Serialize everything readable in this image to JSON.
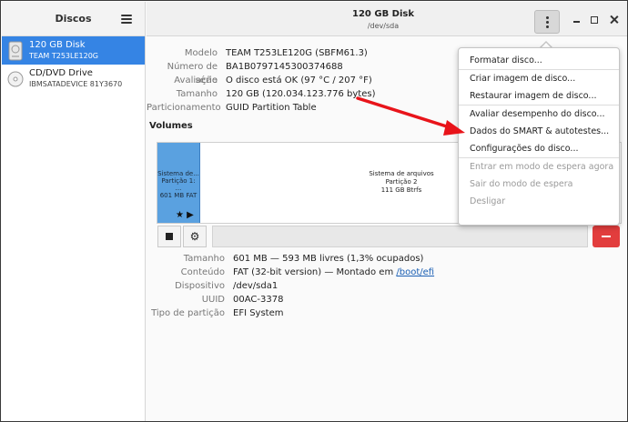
{
  "sidebar": {
    "title": "Discos",
    "items": [
      {
        "name": "120 GB Disk",
        "sub": "TEAM T253LE120G"
      },
      {
        "name": "CD/DVD Drive",
        "sub": "IBMSATADEVICE 81Y3670"
      }
    ]
  },
  "header": {
    "title": "120 GB Disk",
    "subtitle": "/dev/sda"
  },
  "disk_info": [
    {
      "label": "Modelo",
      "value": "TEAM T253LE120G (SBFM61.3)"
    },
    {
      "label": "Número de série",
      "value": "BA1B0797145300374688"
    },
    {
      "label": "Avaliação",
      "value": "O disco está OK (97 °C / 207 °F)"
    },
    {
      "label": "Tamanho",
      "value": "120 GB (120.034.123.776 bytes)"
    },
    {
      "label": "Particionamento",
      "value": "GUID Partition Table"
    }
  ],
  "volumes": {
    "title": "Volumes",
    "partitions": [
      {
        "line1": "Sistema de...",
        "line2": "Partição 1: ...",
        "line3": "601 MB FAT",
        "marks": "★ ▶"
      },
      {
        "line1": "Sistema de arquivos",
        "line2": "Partição 2",
        "line3": "111 GB Btrfs"
      }
    ]
  },
  "partition_details": {
    "size_label": "Tamanho",
    "size_value": "601 MB — 593 MB livres (1,3% ocupados)",
    "content_label": "Conteúdo",
    "content_value": "FAT (32-bit version) — Montado em ",
    "content_link": "/boot/efi",
    "device_label": "Dispositivo",
    "device_value": "/dev/sda1",
    "uuid_label": "UUID",
    "uuid_value": "00AC-3378",
    "type_label": "Tipo de partição",
    "type_value": "EFI System"
  },
  "menu": {
    "items": [
      {
        "label": "Formatar disco...",
        "enabled": true
      },
      {
        "label": "Criar imagem de disco...",
        "enabled": true
      },
      {
        "label": "Restaurar imagem de disco...",
        "enabled": true
      },
      {
        "label": "Avaliar desempenho do disco...",
        "enabled": true
      },
      {
        "label": "Dados do SMART & autotestes...",
        "enabled": true
      },
      {
        "label": "Configurações do disco...",
        "enabled": true
      },
      {
        "label": "Entrar em modo de espera agora",
        "enabled": false
      },
      {
        "label": "Sair do modo de espera",
        "enabled": false
      },
      {
        "label": "Desligar",
        "enabled": false
      }
    ]
  },
  "colors": {
    "accent": "#3584e4",
    "partition_selected": "#5aa1e0",
    "annotation_arrow": "#e8141a",
    "delete_button": "#e23d3d"
  },
  "icons": {
    "menu": "hamburger-icon",
    "kebab": "vertical-dots-icon",
    "disk": "hard-disk-icon",
    "optical": "optical-disc-icon",
    "stop": "stop-icon",
    "settings": "gears-icon",
    "delete": "minus-icon"
  }
}
